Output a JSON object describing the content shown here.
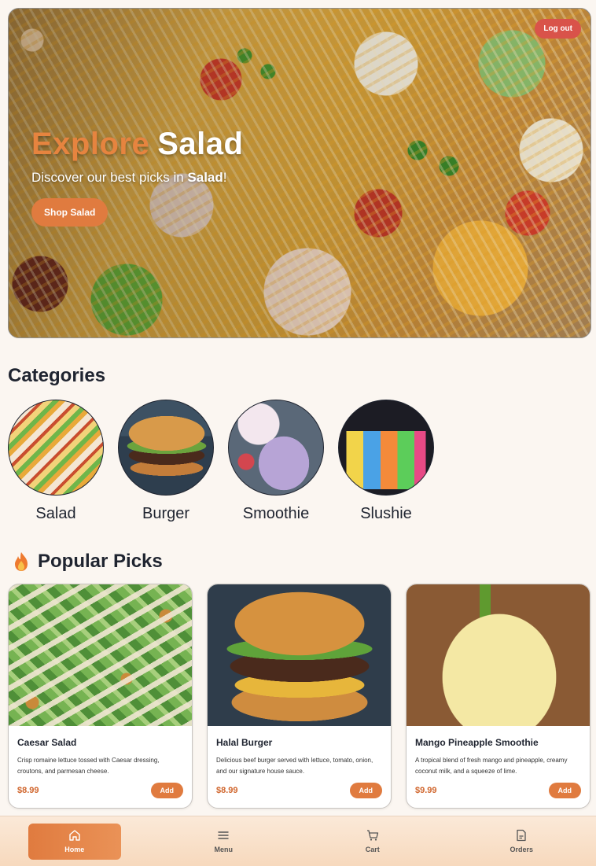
{
  "hero": {
    "logout_label": "Log out",
    "title_accent": "Explore",
    "title_main": "Salad",
    "subtitle_prefix": "Discover our best picks in ",
    "subtitle_bold": "Salad",
    "subtitle_suffix": "!",
    "cta_label": "Shop Salad"
  },
  "categories": {
    "title": "Categories",
    "items": [
      {
        "label": "Salad"
      },
      {
        "label": "Burger"
      },
      {
        "label": "Smoothie"
      },
      {
        "label": "Slushie"
      }
    ]
  },
  "popular": {
    "title": "Popular Picks",
    "icon": "flame-icon",
    "items": [
      {
        "name": "Caesar Salad",
        "desc": "Crisp romaine lettuce tossed with Caesar dressing, croutons, and parmesan cheese.",
        "price": "$8.99",
        "add_label": "Add"
      },
      {
        "name": "Halal Burger",
        "desc": "Delicious beef burger served with lettuce, tomato, onion, and our signature house sauce.",
        "price": "$8.99",
        "add_label": "Add"
      },
      {
        "name": "Mango Pineapple Smoothie",
        "desc": "A tropical blend of fresh mango and pineapple, creamy coconut milk, and a squeeze of lime.",
        "price": "$9.99",
        "add_label": "Add"
      }
    ]
  },
  "nav": {
    "items": [
      {
        "label": "Home",
        "icon": "home-icon",
        "active": true
      },
      {
        "label": "Menu",
        "icon": "menu-icon",
        "active": false
      },
      {
        "label": "Cart",
        "icon": "cart-icon",
        "active": false
      },
      {
        "label": "Orders",
        "icon": "orders-icon",
        "active": false
      }
    ]
  },
  "colors": {
    "accent": "#e07b3f",
    "logout": "#d9534a",
    "price": "#d0652c",
    "background": "#fbf6f1"
  }
}
